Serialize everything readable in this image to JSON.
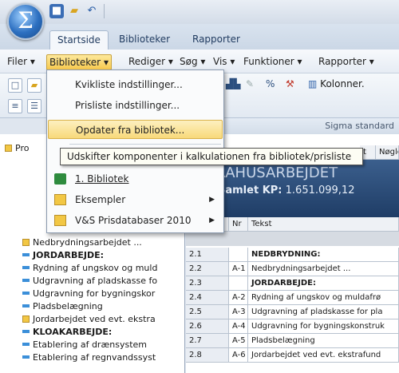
{
  "app": {
    "logo_glyph": "Σ"
  },
  "quick_access": [
    {
      "icon": "save-icon",
      "glyph": "■"
    },
    {
      "icon": "open-folder-icon",
      "glyph": "▰"
    },
    {
      "icon": "undo-icon",
      "glyph": "↶"
    }
  ],
  "ribbon_tabs": [
    {
      "label": "Startside",
      "active": true
    },
    {
      "label": "Biblioteker",
      "active": false
    },
    {
      "label": "Rapporter",
      "active": false
    }
  ],
  "menu": [
    {
      "label": "Filer",
      "open": false
    },
    {
      "label": "Biblioteker",
      "open": true
    },
    {
      "label": "Rediger",
      "open": false
    },
    {
      "label": "Søg",
      "open": false
    },
    {
      "label": "Vis",
      "open": false
    },
    {
      "label": "Funktioner",
      "open": false
    },
    {
      "label": "Rapporter",
      "open": false
    }
  ],
  "toolbar": {
    "columns_label": "Kolonner."
  },
  "sigma_standard": "Sigma standard",
  "dropdown": {
    "items": [
      {
        "label": "Kvikliste indstillinger...",
        "icon": "",
        "highlight": false,
        "submenu": false
      },
      {
        "label": "Prisliste indstillinger...",
        "icon": "",
        "highlight": false,
        "submenu": false
      },
      {
        "label": "Opdater fra bibliotek...",
        "icon": "",
        "highlight": true,
        "submenu": false
      },
      {
        "label": "Udskifter komponenter i kalkulationen fra bibliotek/prisliste",
        "icon": "",
        "highlight": false,
        "submenu": false
      },
      {
        "label": "1. Bibliotek",
        "icon": "excel-icon",
        "highlight": false,
        "submenu": false
      },
      {
        "label": "Eksempler",
        "icon": "folder-icon",
        "highlight": false,
        "submenu": true
      },
      {
        "label": "V&S Prisdatabaser 2010",
        "icon": "folder-icon",
        "highlight": false,
        "submenu": true
      }
    ]
  },
  "tooltip": "Udskifter komponenter i kalkulationen fra bibliotek/prisliste",
  "tree": {
    "root_label": "Pro",
    "items": [
      {
        "label": "Nedbrydningsarbejdet ...",
        "kind": "folder",
        "bold": false
      },
      {
        "label": "JORDARBEJDE:",
        "kind": "doc",
        "bold": true
      },
      {
        "label": "Rydning af ungskov og muld",
        "kind": "doc",
        "bold": false
      },
      {
        "label": "Udgravning af pladskasse fo",
        "kind": "doc",
        "bold": false
      },
      {
        "label": "Udgravning for bygningskor",
        "kind": "doc",
        "bold": false
      },
      {
        "label": "Pladsbelægning",
        "kind": "doc",
        "bold": false
      },
      {
        "label": "Jordarbejdet ved evt. ekstra",
        "kind": "folder",
        "bold": false
      },
      {
        "label": "KLOAKARBEJDE:",
        "kind": "doc",
        "bold": true
      },
      {
        "label": "Etablering af drænsystem",
        "kind": "doc",
        "bold": false
      },
      {
        "label": "Etablering af regnvandssyst",
        "kind": "doc",
        "bold": false
      }
    ]
  },
  "grid": {
    "title_fragment": "A. RAHUSARBEJDET",
    "samlet_label": "Samlet KP:",
    "samlet_value": "1.651.099,12",
    "header_tabs": [
      "t",
      "Nøgle"
    ],
    "col_nr": "Nr",
    "col_tekst": "Tekst",
    "rows": [
      {
        "id": "2.1",
        "nr": "",
        "tekst": "NEDBRYDNING:",
        "bold": true
      },
      {
        "id": "2.2",
        "nr": "A-1",
        "tekst": "Nedbrydningsarbejdet ...",
        "bold": false
      },
      {
        "id": "2.3",
        "nr": "",
        "tekst": "JORDARBEJDE:",
        "bold": true
      },
      {
        "id": "2.4",
        "nr": "A-2",
        "tekst": "Rydning af ungskov og muldafrø",
        "bold": false
      },
      {
        "id": "2.5",
        "nr": "A-3",
        "tekst": "Udgravning af pladskasse for pla",
        "bold": false
      },
      {
        "id": "2.6",
        "nr": "A-4",
        "tekst": "Udgravning for bygningskonstruk",
        "bold": false
      },
      {
        "id": "2.7",
        "nr": "A-5",
        "tekst": "Pladsbelægning",
        "bold": false
      },
      {
        "id": "2.8",
        "nr": "A-6",
        "tekst": "Jordarbejdet ved evt. ekstrafund",
        "bold": false
      }
    ]
  }
}
